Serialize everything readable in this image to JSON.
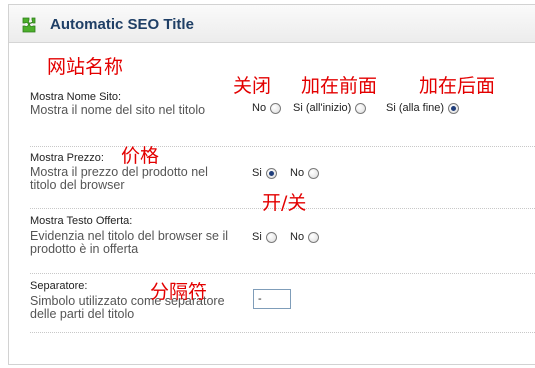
{
  "panel": {
    "title": "Automatic SEO Title"
  },
  "rows": [
    {
      "title": "Mostra Nome Sito:",
      "desc": "Mostra il nome del sito nel titolo",
      "options": [
        {
          "label": "No",
          "checked": false
        },
        {
          "label": "Si (all'inizio)",
          "checked": false
        },
        {
          "label": "Si (alla fine)",
          "checked": true
        }
      ]
    },
    {
      "title": "Mostra Prezzo:",
      "desc": "Mostra il prezzo del prodotto nel titolo del browser",
      "options": [
        {
          "label": "Si",
          "checked": true
        },
        {
          "label": "No",
          "checked": false
        }
      ]
    },
    {
      "title": "Mostra Testo Offerta:",
      "desc": "Evidenzia nel titolo del browser se il prodotto è in offerta",
      "options": [
        {
          "label": "Si",
          "checked": false
        },
        {
          "label": "No",
          "checked": false
        }
      ]
    },
    {
      "title": "Separatore:",
      "desc": "Simbolo utilizzato come separatore delle parti del titolo",
      "input_value": "-"
    }
  ],
  "annotations": {
    "site_name": "网站名称",
    "off": "关闭",
    "add_front": "加在前面",
    "add_back": "加在后面",
    "price": "价格",
    "on_off": "开/关",
    "separator": "分隔符"
  },
  "colors": {
    "title": "#1f3f66",
    "annotation": "#e30000",
    "icon": "#4caf2b"
  },
  "icons": {
    "header": "puzzle-piece-icon"
  }
}
